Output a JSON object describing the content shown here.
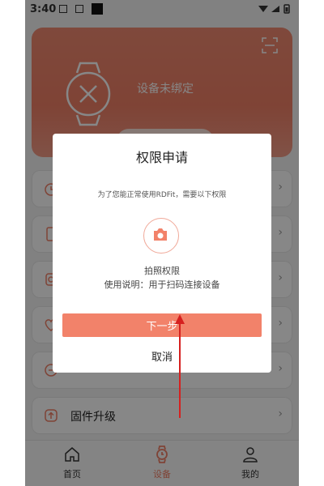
{
  "status_bar": {
    "time": "3:40"
  },
  "device_card": {
    "status_text": "设备未绑定"
  },
  "menu_items": [
    {
      "label": "",
      "icon": "alarm-icon"
    },
    {
      "label": "",
      "icon": "phone-icon"
    },
    {
      "label": "",
      "icon": "watch-face-icon"
    },
    {
      "label": "",
      "icon": "health-icon"
    },
    {
      "label": "",
      "icon": "shake-icon"
    },
    {
      "label": "固件升级",
      "icon": "firmware-upgrade-icon"
    }
  ],
  "tabs": [
    {
      "label": "首页",
      "icon": "home-icon"
    },
    {
      "label": "设备",
      "icon": "watch-icon"
    },
    {
      "label": "我的",
      "icon": "profile-icon"
    }
  ],
  "dialog": {
    "title": "权限申请",
    "description": "为了您能正常使用RDFit，需要以下权限",
    "permission_name": "拍照权限",
    "permission_usage": "使用说明：用于扫码连接设备",
    "next_label": "下一步",
    "cancel_label": "取消"
  },
  "colors": {
    "accent": "#f2826a",
    "arrow": "#d6201f"
  }
}
